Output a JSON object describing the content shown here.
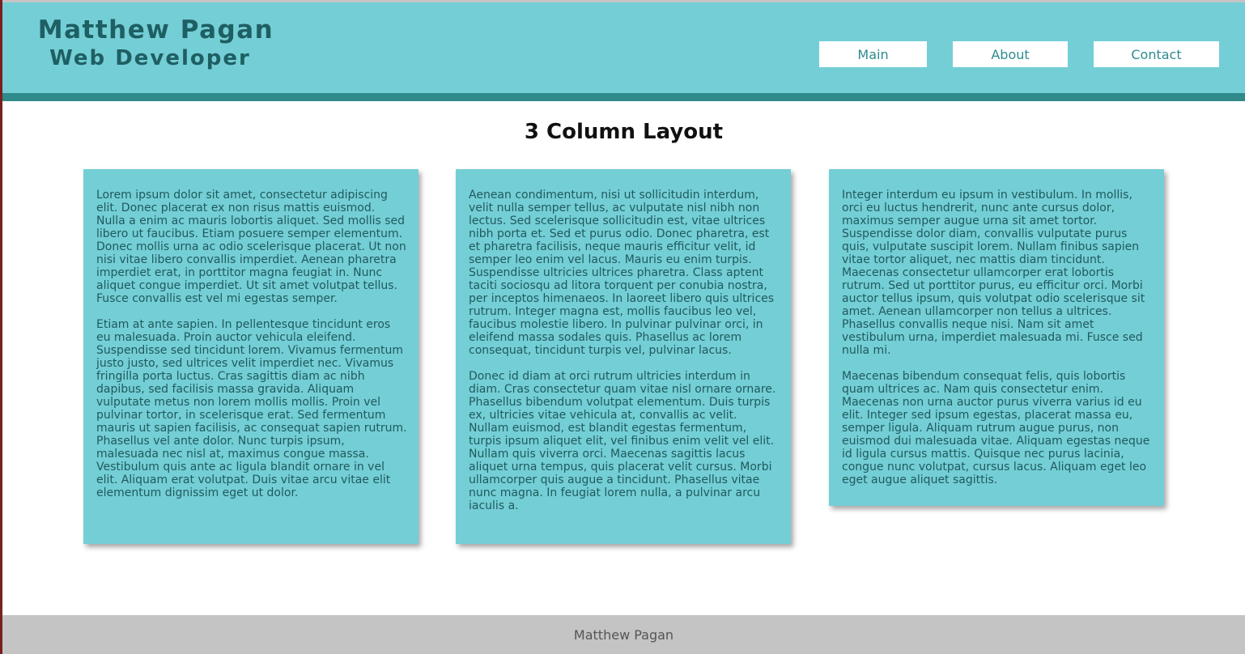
{
  "header": {
    "name": "Matthew Pagan",
    "role": "Web Developer",
    "nav": {
      "main": "Main",
      "about": "About",
      "contact": "Contact"
    }
  },
  "main": {
    "title": "3 Column Layout",
    "columns": [
      {
        "paragraphs": [
          "Lorem ipsum dolor sit amet, consectetur adipiscing elit. Donec placerat ex non risus mattis euismod. Nulla a enim ac mauris lobortis aliquet. Sed mollis sed libero ut faucibus. Etiam posuere semper elementum. Donec mollis urna ac odio scelerisque placerat. Ut non nisi vitae libero convallis imperdiet. Aenean pharetra imperdiet erat, in porttitor magna feugiat in. Nunc aliquet congue imperdiet. Ut sit amet volutpat tellus. Fusce convallis est vel mi egestas semper.",
          "Etiam at ante sapien. In pellentesque tincidunt eros eu malesuada. Proin auctor vehicula eleifend. Suspendisse sed tincidunt lorem. Vivamus fermentum justo justo, sed ultrices velit imperdiet nec. Vivamus fringilla porta luctus. Cras sagittis diam ac nibh dapibus, sed facilisis massa gravida. Aliquam vulputate metus non lorem mollis mollis. Proin vel pulvinar tortor, in scelerisque erat. Sed fermentum mauris ut sapien facilisis, ac consequat sapien rutrum. Phasellus vel ante dolor. Nunc turpis ipsum, malesuada nec nisl at, maximus congue massa. Vestibulum quis ante ac ligula blandit ornare in vel elit. Aliquam erat volutpat. Duis vitae arcu vitae elit elementum dignissim eget ut dolor."
        ]
      },
      {
        "paragraphs": [
          "Aenean condimentum, nisi ut sollicitudin interdum, velit nulla semper tellus, ac vulputate nisl nibh non lectus. Sed scelerisque sollicitudin est, vitae ultrices nibh porta et. Sed et purus odio. Donec pharetra, est et pharetra facilisis, neque mauris efficitur velit, id semper leo enim vel lacus. Mauris eu enim turpis. Suspendisse ultricies ultrices pharetra. Class aptent taciti sociosqu ad litora torquent per conubia nostra, per inceptos himenaeos. In laoreet libero quis ultrices rutrum. Integer magna est, mollis faucibus leo vel, faucibus molestie libero. In pulvinar pulvinar orci, in eleifend massa sodales quis. Phasellus ac lorem consequat, tincidunt turpis vel, pulvinar lacus.",
          "Donec id diam at orci rutrum ultricies interdum in diam. Cras consectetur quam vitae nisl ornare ornare. Phasellus bibendum volutpat elementum. Duis turpis ex, ultricies vitae vehicula at, convallis ac velit. Nullam euismod, est blandit egestas fermentum, turpis ipsum aliquet elit, vel finibus enim velit vel elit. Nullam quis viverra orci. Maecenas sagittis lacus aliquet urna tempus, quis placerat velit cursus. Morbi ullamcorper quis augue a tincidunt. Phasellus vitae nunc magna. In feugiat lorem nulla, a pulvinar arcu iaculis a."
        ]
      },
      {
        "paragraphs": [
          "Integer interdum eu ipsum in vestibulum. In mollis, orci eu luctus hendrerit, nunc ante cursus dolor, maximus semper augue urna sit amet tortor. Suspendisse dolor diam, convallis vulputate purus quis, vulputate suscipit lorem. Nullam finibus sapien vitae tortor aliquet, nec mattis diam tincidunt. Maecenas consectetur ullamcorper erat lobortis rutrum. Sed ut porttitor purus, eu efficitur orci. Morbi auctor tellus ipsum, quis volutpat odio scelerisque sit amet. Aenean ullamcorper non tellus a ultrices. Phasellus convallis neque nisi. Nam sit amet vestibulum urna, imperdiet malesuada mi. Fusce sed nulla mi.",
          "Maecenas bibendum consequat felis, quis lobortis quam ultrices ac. Nam quis consectetur enim. Maecenas non urna auctor purus viverra varius id eu elit. Integer sed ipsum egestas, placerat massa eu, semper ligula. Aliquam rutrum augue purus, non euismod dui malesuada vitae. Aliquam egestas neque id ligula cursus mattis. Quisque nec purus lacinia, congue nunc volutpat, cursus lacus. Aliquam eget leo eget augue aliquet sagittis."
        ]
      }
    ]
  },
  "footer": {
    "text": "Matthew Pagan"
  },
  "colors": {
    "header_bg": "#74ced5",
    "header_stripe": "#2f8a89",
    "brand_text": "#1e5f63",
    "nav_text": "#2e8b8f",
    "card_bg": "#74ced5",
    "card_text": "#1f5a5e",
    "footer_bg": "#c4c4c4",
    "footer_text": "#555555"
  }
}
